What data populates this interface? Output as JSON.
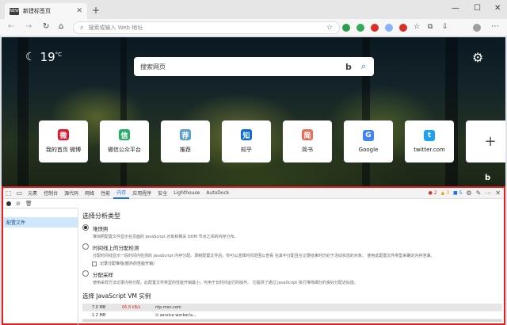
{
  "browser": {
    "tab_title": "新建标签页",
    "tab_favicon": "NEW",
    "address_placeholder": "搜索或输入 Web 地址"
  },
  "ntp": {
    "temperature": "19",
    "temp_unit": "°C",
    "search_placeholder": "搜索网页",
    "search_logo": "b",
    "tiles": [
      {
        "label": "我的首页 微博",
        "icon": "weibo-icon",
        "color": "#e6162d",
        "glyph": "微"
      },
      {
        "label": "微信公众平台",
        "icon": "wechat-icon",
        "color": "#2aae67",
        "glyph": "信"
      },
      {
        "label": "推荐",
        "icon": "recommend-icon",
        "color": "#5aa0d0",
        "glyph": "荐"
      },
      {
        "label": "知乎",
        "icon": "zhihu-icon",
        "color": "#0a6dd9",
        "glyph": "知"
      },
      {
        "label": "简书",
        "icon": "jianshu-icon",
        "color": "#ea6f5a",
        "glyph": "简"
      },
      {
        "label": "Google",
        "icon": "google-icon",
        "color": "#4285f4",
        "glyph": "G"
      },
      {
        "label": "twitter.com",
        "icon": "twitter-icon",
        "color": "#1da1f2",
        "glyph": "t"
      }
    ],
    "bing_corner": "b"
  },
  "devtools": {
    "tabs": [
      "元素",
      "控制台",
      "源代码",
      "网络",
      "性能",
      "内存",
      "应用程序",
      "安全",
      "Lighthouse",
      "AutoDock"
    ],
    "active_tab": "内存",
    "errors": "2",
    "warnings": "3",
    "infos": "5",
    "sidebar_item": "配置文件",
    "heading": "选择分析类型",
    "options": [
      {
        "title": "堆快照",
        "desc": "堆快照配置文件显示在页面的 JavaScript 对象和相关 DOM 节点之间的内存分布。"
      },
      {
        "title": "时间线上的分配检测",
        "desc": "分配时间线显示一段时间内检测的 JavaScript 内存分配。录制配置文件后，你可以选择时间范围以查看 在其中分配且在记录结束时仍处于活动状态的对象。 使用此配置文件类型来确定内存泄漏。"
      },
      {
        "title": "分配采样",
        "desc": "使用采样方法记录内存分配。此配置文件类型的性能开销最小，可用于长时间运行的操作。 它提供了通过 JavaScript 执行堆栈细分的良好分配近似值。"
      }
    ],
    "checkbox_label": "记录分配堆栈(额外的性能开销)",
    "vm_heading": "选择 JavaScript VM 实例",
    "vm_rows": [
      {
        "size": "7.0 MB",
        "rate": "66.8 kB/s",
        "name": "ntp.msn.com"
      },
      {
        "size": "1.2 MB",
        "rate": "",
        "name": "⊙ service worker/a..."
      }
    ]
  }
}
